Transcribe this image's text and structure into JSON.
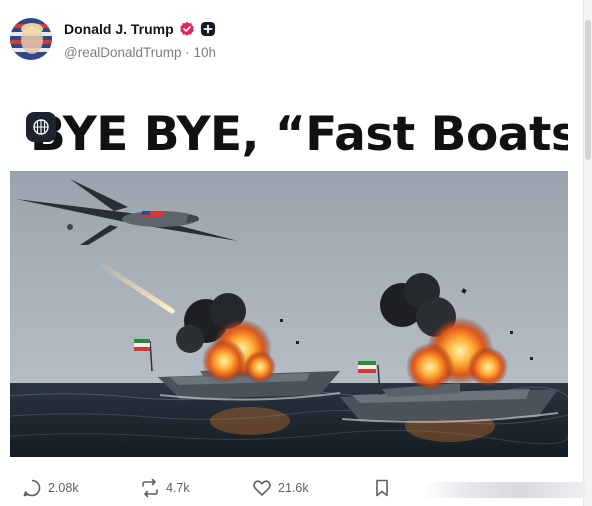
{
  "post": {
    "author": {
      "display_name": "Donald J. Trump",
      "handle": "@realDonaldTrump",
      "separator": "·",
      "time": "10h",
      "verified_icon": "verified-badge-icon",
      "follow_icon": "plus-icon"
    },
    "image": {
      "headline": "BYE BYE, “Fast Boats”",
      "overlay_icon": "grid-icon"
    },
    "actions": {
      "replies": "2.08k",
      "reposts": "4.7k",
      "likes": "21.6k",
      "bookmark_icon": "bookmark-icon"
    }
  },
  "colors": {
    "verified": "#e0245e",
    "muted_text": "#7a7f86",
    "text": "#0f1419"
  }
}
